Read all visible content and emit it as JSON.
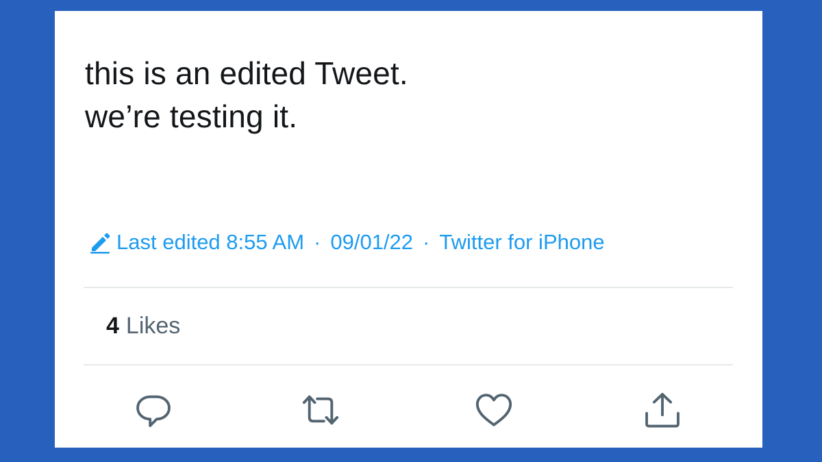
{
  "tweet": {
    "lines": [
      "this is an edited Tweet.",
      "we’re testing it."
    ]
  },
  "meta": {
    "edit_icon": "pencil-icon",
    "edited_label": "Last edited 8:55 AM",
    "separator": "·",
    "date": "09/01/22",
    "source": "Twitter for iPhone"
  },
  "stats": {
    "likes_count": "4",
    "likes_label": "Likes"
  },
  "actions": [
    {
      "name": "reply",
      "icon": "reply-icon"
    },
    {
      "name": "retweet",
      "icon": "retweet-icon"
    },
    {
      "name": "like",
      "icon": "heart-icon"
    },
    {
      "name": "share",
      "icon": "share-icon"
    }
  ],
  "colors": {
    "background": "#2860bd",
    "card": "#ffffff",
    "text": "#14171a",
    "accent": "#1d9bf0",
    "secondary": "#536471",
    "divider": "#e6e9eb"
  }
}
